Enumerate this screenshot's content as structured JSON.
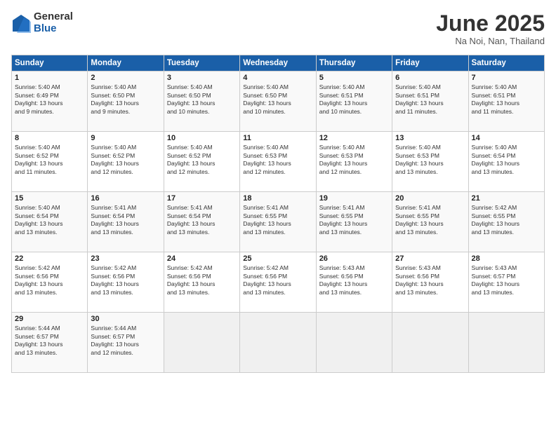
{
  "logo": {
    "general": "General",
    "blue": "Blue"
  },
  "title": "June 2025",
  "location": "Na Noi, Nan, Thailand",
  "days_of_week": [
    "Sunday",
    "Monday",
    "Tuesday",
    "Wednesday",
    "Thursday",
    "Friday",
    "Saturday"
  ],
  "weeks": [
    [
      {
        "day": 1,
        "lines": [
          "Sunrise: 5:40 AM",
          "Sunset: 6:49 PM",
          "Daylight: 13 hours",
          "and 9 minutes."
        ]
      },
      {
        "day": 2,
        "lines": [
          "Sunrise: 5:40 AM",
          "Sunset: 6:50 PM",
          "Daylight: 13 hours",
          "and 9 minutes."
        ]
      },
      {
        "day": 3,
        "lines": [
          "Sunrise: 5:40 AM",
          "Sunset: 6:50 PM",
          "Daylight: 13 hours",
          "and 10 minutes."
        ]
      },
      {
        "day": 4,
        "lines": [
          "Sunrise: 5:40 AM",
          "Sunset: 6:50 PM",
          "Daylight: 13 hours",
          "and 10 minutes."
        ]
      },
      {
        "day": 5,
        "lines": [
          "Sunrise: 5:40 AM",
          "Sunset: 6:51 PM",
          "Daylight: 13 hours",
          "and 10 minutes."
        ]
      },
      {
        "day": 6,
        "lines": [
          "Sunrise: 5:40 AM",
          "Sunset: 6:51 PM",
          "Daylight: 13 hours",
          "and 11 minutes."
        ]
      },
      {
        "day": 7,
        "lines": [
          "Sunrise: 5:40 AM",
          "Sunset: 6:51 PM",
          "Daylight: 13 hours",
          "and 11 minutes."
        ]
      }
    ],
    [
      {
        "day": 8,
        "lines": [
          "Sunrise: 5:40 AM",
          "Sunset: 6:52 PM",
          "Daylight: 13 hours",
          "and 11 minutes."
        ]
      },
      {
        "day": 9,
        "lines": [
          "Sunrise: 5:40 AM",
          "Sunset: 6:52 PM",
          "Daylight: 13 hours",
          "and 12 minutes."
        ]
      },
      {
        "day": 10,
        "lines": [
          "Sunrise: 5:40 AM",
          "Sunset: 6:52 PM",
          "Daylight: 13 hours",
          "and 12 minutes."
        ]
      },
      {
        "day": 11,
        "lines": [
          "Sunrise: 5:40 AM",
          "Sunset: 6:53 PM",
          "Daylight: 13 hours",
          "and 12 minutes."
        ]
      },
      {
        "day": 12,
        "lines": [
          "Sunrise: 5:40 AM",
          "Sunset: 6:53 PM",
          "Daylight: 13 hours",
          "and 12 minutes."
        ]
      },
      {
        "day": 13,
        "lines": [
          "Sunrise: 5:40 AM",
          "Sunset: 6:53 PM",
          "Daylight: 13 hours",
          "and 13 minutes."
        ]
      },
      {
        "day": 14,
        "lines": [
          "Sunrise: 5:40 AM",
          "Sunset: 6:54 PM",
          "Daylight: 13 hours",
          "and 13 minutes."
        ]
      }
    ],
    [
      {
        "day": 15,
        "lines": [
          "Sunrise: 5:40 AM",
          "Sunset: 6:54 PM",
          "Daylight: 13 hours",
          "and 13 minutes."
        ]
      },
      {
        "day": 16,
        "lines": [
          "Sunrise: 5:41 AM",
          "Sunset: 6:54 PM",
          "Daylight: 13 hours",
          "and 13 minutes."
        ]
      },
      {
        "day": 17,
        "lines": [
          "Sunrise: 5:41 AM",
          "Sunset: 6:54 PM",
          "Daylight: 13 hours",
          "and 13 minutes."
        ]
      },
      {
        "day": 18,
        "lines": [
          "Sunrise: 5:41 AM",
          "Sunset: 6:55 PM",
          "Daylight: 13 hours",
          "and 13 minutes."
        ]
      },
      {
        "day": 19,
        "lines": [
          "Sunrise: 5:41 AM",
          "Sunset: 6:55 PM",
          "Daylight: 13 hours",
          "and 13 minutes."
        ]
      },
      {
        "day": 20,
        "lines": [
          "Sunrise: 5:41 AM",
          "Sunset: 6:55 PM",
          "Daylight: 13 hours",
          "and 13 minutes."
        ]
      },
      {
        "day": 21,
        "lines": [
          "Sunrise: 5:42 AM",
          "Sunset: 6:55 PM",
          "Daylight: 13 hours",
          "and 13 minutes."
        ]
      }
    ],
    [
      {
        "day": 22,
        "lines": [
          "Sunrise: 5:42 AM",
          "Sunset: 6:56 PM",
          "Daylight: 13 hours",
          "and 13 minutes."
        ]
      },
      {
        "day": 23,
        "lines": [
          "Sunrise: 5:42 AM",
          "Sunset: 6:56 PM",
          "Daylight: 13 hours",
          "and 13 minutes."
        ]
      },
      {
        "day": 24,
        "lines": [
          "Sunrise: 5:42 AM",
          "Sunset: 6:56 PM",
          "Daylight: 13 hours",
          "and 13 minutes."
        ]
      },
      {
        "day": 25,
        "lines": [
          "Sunrise: 5:42 AM",
          "Sunset: 6:56 PM",
          "Daylight: 13 hours",
          "and 13 minutes."
        ]
      },
      {
        "day": 26,
        "lines": [
          "Sunrise: 5:43 AM",
          "Sunset: 6:56 PM",
          "Daylight: 13 hours",
          "and 13 minutes."
        ]
      },
      {
        "day": 27,
        "lines": [
          "Sunrise: 5:43 AM",
          "Sunset: 6:56 PM",
          "Daylight: 13 hours",
          "and 13 minutes."
        ]
      },
      {
        "day": 28,
        "lines": [
          "Sunrise: 5:43 AM",
          "Sunset: 6:57 PM",
          "Daylight: 13 hours",
          "and 13 minutes."
        ]
      }
    ],
    [
      {
        "day": 29,
        "lines": [
          "Sunrise: 5:44 AM",
          "Sunset: 6:57 PM",
          "Daylight: 13 hours",
          "and 13 minutes."
        ]
      },
      {
        "day": 30,
        "lines": [
          "Sunrise: 5:44 AM",
          "Sunset: 6:57 PM",
          "Daylight: 13 hours",
          "and 12 minutes."
        ]
      },
      {
        "day": null,
        "lines": []
      },
      {
        "day": null,
        "lines": []
      },
      {
        "day": null,
        "lines": []
      },
      {
        "day": null,
        "lines": []
      },
      {
        "day": null,
        "lines": []
      }
    ]
  ]
}
